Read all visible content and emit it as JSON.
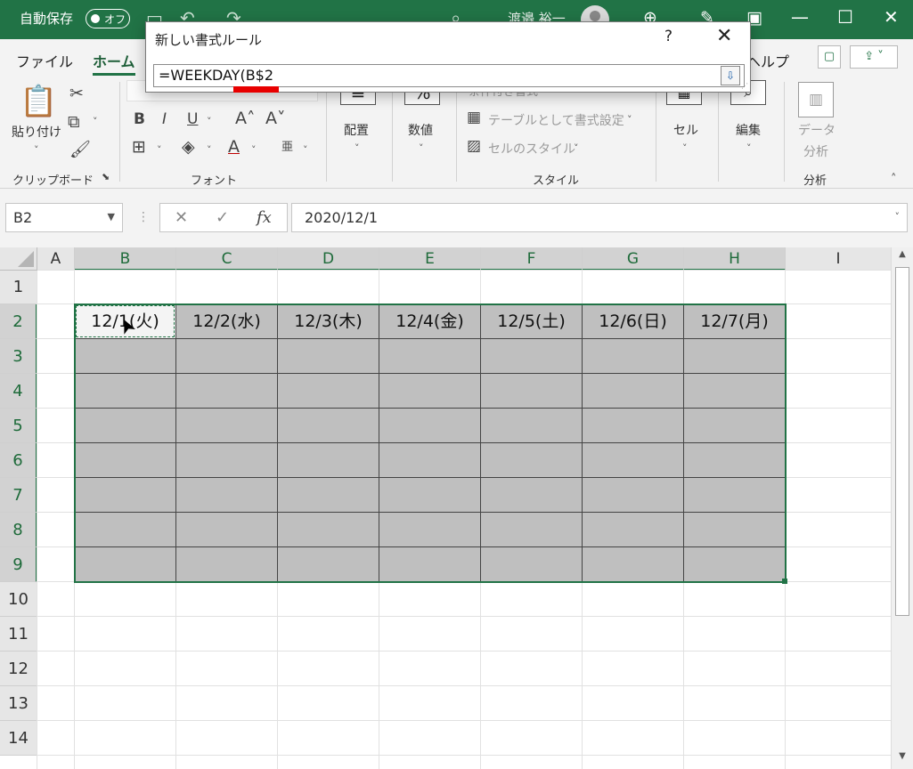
{
  "title_bar": {
    "autosave_label": "自動保存",
    "autosave_state": "オフ",
    "user_name": "渡邉 裕一"
  },
  "ribbon": {
    "tabs": [
      "ファイル",
      "ホーム",
      "ヘルプ"
    ],
    "active_tab": "ホーム",
    "clipboard": {
      "paste_label": "貼り付け",
      "group_label": "クリップボード"
    },
    "font": {
      "group_label": "フォント"
    },
    "alignment": {
      "label": "配置"
    },
    "number": {
      "label": "数値",
      "glyph": "%"
    },
    "styles": {
      "conditional_format": "条件付き書式",
      "format_as_table": "テーブルとして書式設定",
      "cell_styles": "セルのスタイル",
      "group_label": "スタイル"
    },
    "cells": {
      "label": "セル"
    },
    "editing": {
      "label": "編集"
    },
    "analysis": {
      "label_line1": "データ",
      "label_line2": "分析",
      "group_label": "分析"
    }
  },
  "formula_bar": {
    "name_box": "B2",
    "formula": "2020/12/1"
  },
  "dialog": {
    "title": "新しい書式ルール",
    "help": "?",
    "formula_input": "=WEEKDAY(B$2"
  },
  "sheet": {
    "columns": [
      "A",
      "B",
      "C",
      "D",
      "E",
      "F",
      "G",
      "H",
      "I"
    ],
    "rows": [
      "1",
      "2",
      "3",
      "4",
      "5",
      "6",
      "7",
      "8",
      "9",
      "10",
      "11",
      "12",
      "13",
      "14"
    ],
    "header_cells": [
      "12/1(火)",
      "12/2(水)",
      "12/3(木)",
      "12/4(金)",
      "12/5(土)",
      "12/6(日)",
      "12/7(月)"
    ],
    "selected_range": "B2:H9",
    "active_cell": "B2"
  },
  "colors": {
    "accent": "#217346",
    "cell_fill": "#bfbfbf",
    "highlight_mark": "#e80000"
  }
}
